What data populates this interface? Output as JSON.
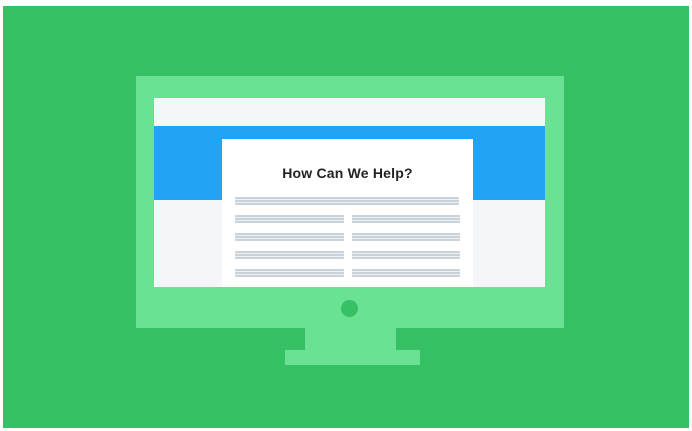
{
  "illustration": {
    "card_title": "How Can We Help?"
  },
  "colors": {
    "background": "#36c164",
    "monitor": "#6be193",
    "screen": "#f4f6f9",
    "header_band": "#21a4f4",
    "card": "#ffffff",
    "text_lines": "#c9d1d9"
  },
  "icons": {
    "power": "power-button-dot"
  }
}
